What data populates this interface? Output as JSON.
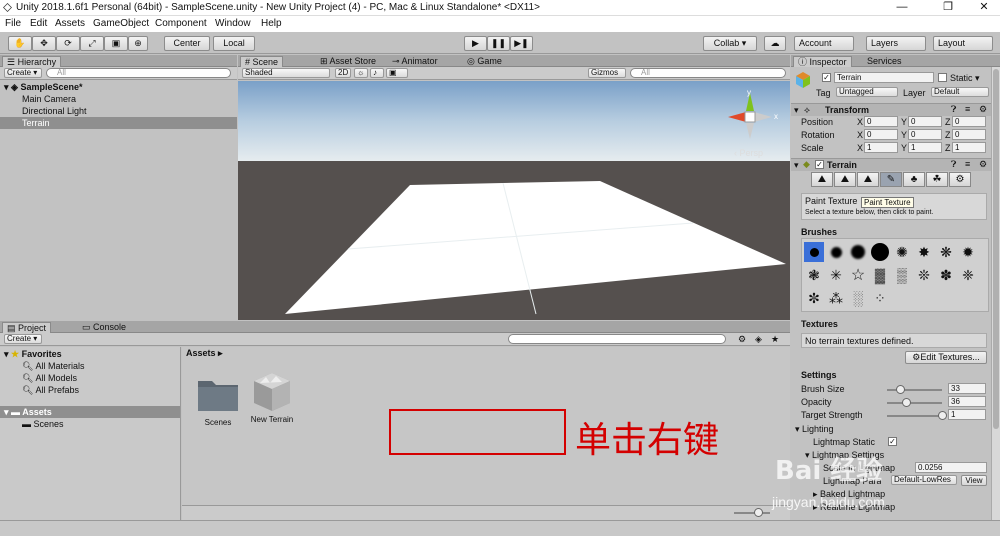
{
  "window": {
    "title": "Unity 2018.1.6f1 Personal (64bit) - SampleScene.unity - New Unity Project (4) - PC, Mac & Linux Standalone* <DX11>",
    "minimize": "—",
    "maximize": "❐",
    "close": "✕"
  },
  "menu": {
    "items": [
      "File",
      "Edit",
      "Assets",
      "GameObject",
      "Component",
      "Window",
      "Help"
    ]
  },
  "toolbar": {
    "center_label": "Center",
    "local_label": "Local",
    "play_icon": "▶",
    "pause_icon": "❚❚",
    "step_icon": "▶❚",
    "collab_label": "Collab ▾",
    "cloud_icon": "☁",
    "account_label": "Account",
    "layers_label": "Layers",
    "layout_label": "Layout"
  },
  "hierarchy": {
    "tab_label": "Hierarchy",
    "create_label": "Create ▾",
    "search_placeholder": "All",
    "scene_name": "SampleScene*",
    "items": [
      "Main Camera",
      "Directional Light",
      "Terrain"
    ]
  },
  "scene_view": {
    "tabs": [
      "Scene",
      "Asset Store",
      "Animator",
      "Game"
    ],
    "shading_mode": "Shaded",
    "mode_2d": "2D",
    "gizmos_label": "Gizmos",
    "search_placeholder": "All",
    "persp_label": "‹ Persp",
    "axis_y": "y",
    "axis_x": "x"
  },
  "project": {
    "tabs": [
      "Project",
      "Console"
    ],
    "create_label": "Create ▾",
    "favorites_label": "Favorites",
    "favorites": [
      "All Materials",
      "All Models",
      "All Prefabs"
    ],
    "assets_label": "Assets",
    "asset_folders": [
      "Scenes"
    ],
    "breadcrumb": "Assets ▸",
    "items": [
      "Scenes",
      "New Terrain"
    ],
    "annotation_text": "单击右键",
    "annotation_color": "#d40000"
  },
  "inspector": {
    "tabs": [
      "Inspector",
      "Services"
    ],
    "object_name": "Terrain",
    "static_label": "Static",
    "tag_label": "Tag",
    "tag_value": "Untagged",
    "layer_label": "Layer",
    "layer_value": "Default",
    "transform": {
      "title": "Transform",
      "rows": [
        {
          "label": "Position",
          "x": "0",
          "y": "0",
          "z": "0"
        },
        {
          "label": "Rotation",
          "x": "0",
          "y": "0",
          "z": "0"
        },
        {
          "label": "Scale",
          "x": "1",
          "y": "1",
          "z": "1"
        }
      ],
      "axis_x": "X",
      "axis_y": "Y",
      "axis_z": "Z"
    },
    "terrain": {
      "title": "Terrain",
      "tool_icons": [
        "⛰",
        "⛰",
        "⛰",
        "✎",
        "♣",
        "☘",
        "⚙"
      ],
      "section_label": "Paint Texture",
      "tooltip": "Paint Texture",
      "help_text": "Select a texture below, then click to paint.",
      "brushes_label": "Brushes",
      "textures_label": "Textures",
      "textures_empty": "No terrain textures defined.",
      "edit_textures_label": "Edit Textures...",
      "settings_label": "Settings",
      "brush_size_label": "Brush Size",
      "brush_size_value": "33",
      "brush_size_fraction": 0.25,
      "opacity_label": "Opacity",
      "opacity_value": "36",
      "opacity_fraction": 0.36,
      "target_strength_label": "Target Strength",
      "target_strength_value": "1",
      "target_strength_fraction": 1.0,
      "lighting_label": "Lighting",
      "lightmap_static_label": "Lightmap Static",
      "lightmap_settings_label": "Lightmap Settings",
      "scale_in_lightmap_label": "Scale In Lightmap",
      "scale_in_lightmap_value": "0.0256",
      "lightmap_params_label": "Lightmap Parameters",
      "lightmap_params_value": "Default-LowRes",
      "view_label": "View",
      "baked_lightmap_label": "Baked Lightmap",
      "realtime_lightmap_label": "Realtime Lightmap"
    }
  },
  "watermark": {
    "brand": "Bai 经验",
    "url": "jingyan.baidu.com"
  }
}
